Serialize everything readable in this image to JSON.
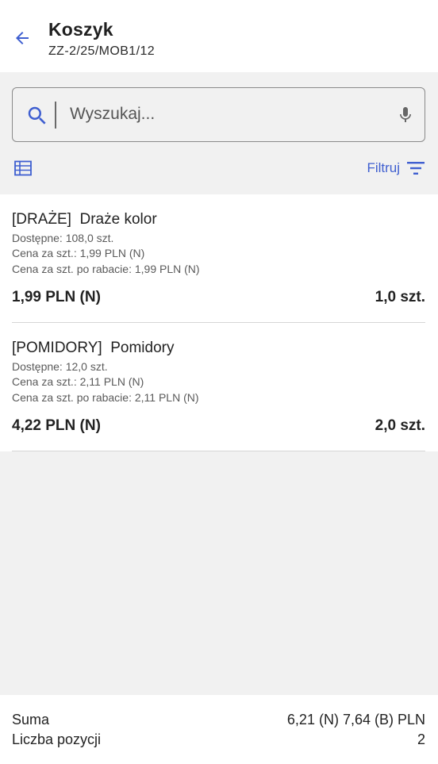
{
  "header": {
    "title": "Koszyk",
    "subtitle": "ZZ-2/25/MOB1/12",
    "back_icon": "arrow-left-icon",
    "accent_color": "#3f5fd0"
  },
  "search": {
    "placeholder": "Wyszukaj...",
    "value": ""
  },
  "toolbar": {
    "table_icon": "table-view-icon",
    "filter_label": "Filtruj",
    "filter_icon": "filter-icon"
  },
  "items": [
    {
      "name": "[DRAŻE]  Draże kolor",
      "available": "Dostępne: 108,0 szt.",
      "unit_price": "Cena za szt.: 1,99 PLN (N)",
      "discount_price": "Cena za szt. po rabacie: 1,99 PLN (N)",
      "total": "1,99 PLN (N)",
      "quantity": "1,0 szt."
    },
    {
      "name": "[POMIDORY]  Pomidory",
      "available": "Dostępne: 12,0 szt.",
      "unit_price": "Cena za szt.: 2,11 PLN (N)",
      "discount_price": "Cena za szt. po rabacie: 2,11 PLN (N)",
      "total": "4,22 PLN (N)",
      "quantity": "2,0 szt."
    }
  ],
  "footer": {
    "sum_label": "Suma",
    "sum_value": "6,21 (N) 7,64 (B) PLN",
    "count_label": "Liczba pozycji",
    "count_value": "2"
  }
}
